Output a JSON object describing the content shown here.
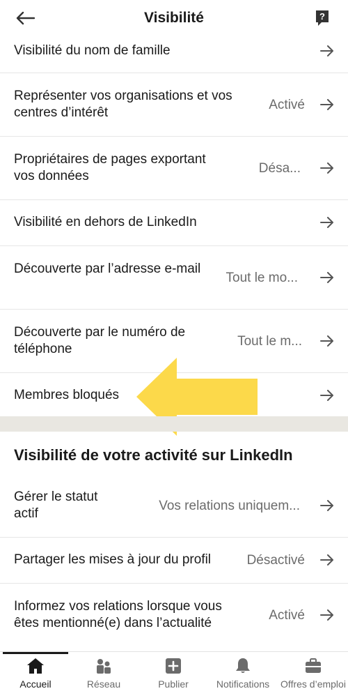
{
  "header": {
    "title": "Visibilité"
  },
  "rows": [
    {
      "label": "Visibilité du nom de famille",
      "value": ""
    },
    {
      "label": "Représenter vos organisations et vos centres d’intérêt",
      "value": "Activé"
    },
    {
      "label": "Propriétaires de pages exportant vos données",
      "value": "Désa..."
    },
    {
      "label": "Visibilité en dehors de LinkedIn",
      "value": ""
    },
    {
      "label": "Découverte par l’adresse e-mail",
      "value": "Tout le mo..."
    },
    {
      "label": "Découverte par le numéro de téléphone",
      "value": "Tout le m..."
    },
    {
      "label": "Membres bloqués",
      "value": ""
    }
  ],
  "section": {
    "title": "Visibilité de votre activité sur LinkedIn"
  },
  "activity_rows": [
    {
      "label": "Gérer le statut actif",
      "value": "Vos relations uniquem..."
    },
    {
      "label": "Partager les mises à jour du profil",
      "value": "Désactivé"
    },
    {
      "label": "Informez vos relations lorsque vous êtes mentionné(e) dans l’actualité",
      "value": "Activé"
    }
  ],
  "nav": [
    {
      "label": "Accueil",
      "icon": "home-icon",
      "active": true
    },
    {
      "label": "Réseau",
      "icon": "network-icon"
    },
    {
      "label": "Publier",
      "icon": "post-icon"
    },
    {
      "label": "Notifications",
      "icon": "bell-icon"
    },
    {
      "label": "Offres d’emploi",
      "icon": "briefcase-icon"
    }
  ],
  "colors": {
    "callout_arrow": "#fcd94a",
    "section_divider": "#e9e7e1",
    "value_text": "#6b6b6b"
  }
}
